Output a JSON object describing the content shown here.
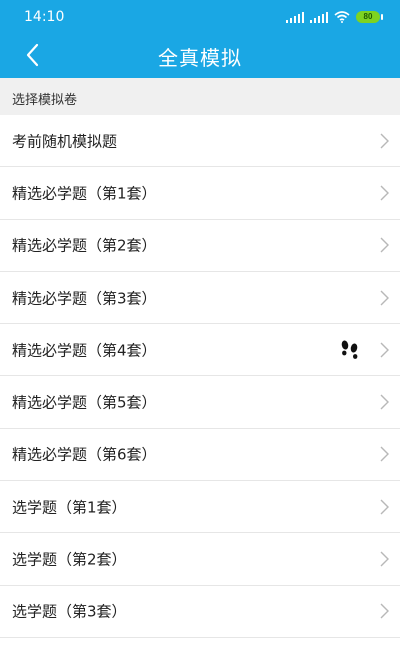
{
  "status_bar": {
    "time": "14:10",
    "battery": "80"
  },
  "header": {
    "title": "全真模拟"
  },
  "section": {
    "title": "选择模拟卷"
  },
  "items": [
    {
      "label": "考前随机模拟题"
    },
    {
      "label": "精选必学题（第1套）"
    },
    {
      "label": "精选必学题（第2套）"
    },
    {
      "label": "精选必学题（第3套）"
    },
    {
      "label": "精选必学题（第4套）",
      "icon": "footprint-icon"
    },
    {
      "label": "精选必学题（第5套）"
    },
    {
      "label": "精选必学题（第6套）"
    },
    {
      "label": "选学题（第1套）"
    },
    {
      "label": "选学题（第2套）"
    },
    {
      "label": "选学题（第3套）"
    }
  ],
  "colors": {
    "header": "#1aa7e4",
    "section_background": "#f0f0f0",
    "battery": "#7ed321"
  },
  "icons": {
    "back": "back-arrow-icon",
    "row_arrow": "chevron-right-icon",
    "marker": "footprint-icon",
    "signal": "signal-icon",
    "wifi": "wifi-icon",
    "battery": "battery-icon"
  }
}
